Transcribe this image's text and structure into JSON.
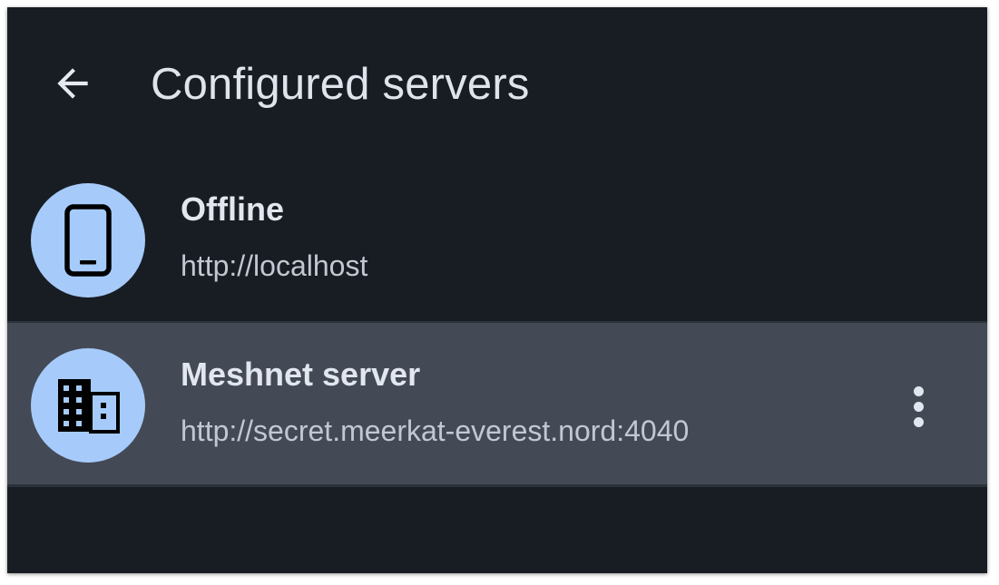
{
  "header": {
    "title": "Configured servers",
    "back_icon": "arrow-back-icon"
  },
  "servers": [
    {
      "name": "Offline",
      "url": "http://localhost",
      "icon": "smartphone-icon"
    },
    {
      "name": "Meshnet server",
      "url": "http://secret.meerkat-everest.nord:4040",
      "icon": "building-icon",
      "menu_icon": "more-vert-icon",
      "selected": true
    }
  ],
  "colors": {
    "background": "#181d23",
    "selected_row": "#434a55",
    "avatar": "#a6cbfb",
    "title_text": "#dfe3eb",
    "secondary_text": "#c2c8d2"
  }
}
